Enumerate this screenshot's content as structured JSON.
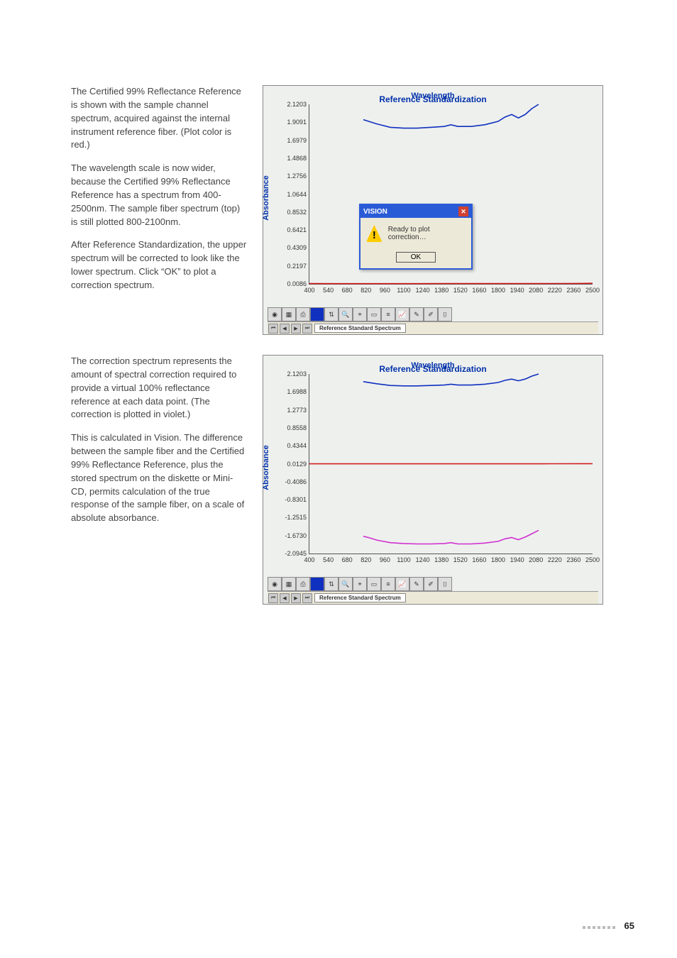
{
  "paragraphs": {
    "p1": "The Certified 99% Reflectance Reference is shown with the sample channel spectrum, acquired against the internal instrument reference fiber. (Plot color is red.)",
    "p2": "The wavelength scale is now wider, because the Certified 99% Reflectance Reference has a spectrum from 400-2500nm. The sample fiber spectrum (top) is still plotted 800-2100nm.",
    "p3": "After Reference Standardization, the upper spectrum will be corrected to look like the lower spectrum. Click “OK” to plot a correction spectrum.",
    "p4": "The correction spectrum represents the amount of spectral correction required to provide a virtual 100% reflectance reference at each data point. (The correction is plotted in violet.)",
    "p5": "This is calculated in Vision. The difference between the sample fiber and the Certified 99% Reflectance Reference, plus the stored spectrum on the diskette or Mini-CD, permits calculation of the true response of the sample fiber, on a scale of absolute absorbance."
  },
  "dialog": {
    "title": "VISION",
    "message": "Ready to plot correction…",
    "ok": "OK"
  },
  "tab": {
    "name": "Reference Standard Spectrum"
  },
  "page_number": "65",
  "chart_data": [
    {
      "type": "line",
      "title": "Reference Standardization",
      "xlabel": "Wavelength",
      "ylabel": "Absorbance",
      "xlim": [
        400,
        2500
      ],
      "ylim": [
        0.0086,
        2.1203
      ],
      "yticks": [
        2.1203,
        1.9091,
        1.6979,
        1.4868,
        1.2756,
        1.0644,
        0.8532,
        0.6421,
        0.4309,
        0.2197,
        0.0086
      ],
      "xticks": [
        400,
        540,
        680,
        820,
        960,
        1100,
        1240,
        1380,
        1520,
        1660,
        1800,
        1940,
        2080,
        2220,
        2360,
        2500
      ],
      "series": [
        {
          "name": "sample-fiber",
          "color": "#1030c0",
          "x": [
            800,
            900,
            1000,
            1100,
            1200,
            1300,
            1400,
            1450,
            1500,
            1600,
            1700,
            1800,
            1850,
            1900,
            1950,
            2000,
            2050,
            2100
          ],
          "y": [
            1.94,
            1.89,
            1.85,
            1.84,
            1.84,
            1.85,
            1.86,
            1.88,
            1.86,
            1.86,
            1.88,
            1.92,
            1.97,
            2.0,
            1.96,
            2.0,
            2.07,
            2.12
          ]
        },
        {
          "name": "reflectance-reference",
          "color": "#d02020",
          "x": [
            400,
            600,
            800,
            1000,
            1200,
            1400,
            1600,
            1800,
            2000,
            2200,
            2400,
            2500
          ],
          "y": [
            0.012,
            0.011,
            0.011,
            0.011,
            0.011,
            0.012,
            0.012,
            0.012,
            0.012,
            0.013,
            0.014,
            0.015
          ]
        }
      ]
    },
    {
      "type": "line",
      "title": "Reference Standardization",
      "xlabel": "Wavelength",
      "ylabel": "Absorbance",
      "xlim": [
        400,
        2500
      ],
      "ylim": [
        -2.0945,
        2.1203
      ],
      "yticks": [
        2.1203,
        1.6988,
        1.2773,
        0.8558,
        0.4344,
        0.0129,
        -0.4086,
        -0.8301,
        -1.2515,
        -1.673,
        -2.0945
      ],
      "xticks": [
        400,
        540,
        680,
        820,
        960,
        1100,
        1240,
        1380,
        1520,
        1660,
        1800,
        1940,
        2080,
        2220,
        2360,
        2500
      ],
      "series": [
        {
          "name": "sample-fiber",
          "color": "#1030c0",
          "x": [
            800,
            900,
            1000,
            1100,
            1200,
            1300,
            1400,
            1450,
            1500,
            1600,
            1700,
            1800,
            1850,
            1900,
            1950,
            2000,
            2050,
            2100
          ],
          "y": [
            1.94,
            1.89,
            1.85,
            1.84,
            1.84,
            1.85,
            1.86,
            1.88,
            1.86,
            1.86,
            1.88,
            1.92,
            1.97,
            2.0,
            1.96,
            2.0,
            2.07,
            2.12
          ]
        },
        {
          "name": "reflectance-reference",
          "color": "#d02020",
          "x": [
            400,
            600,
            800,
            1000,
            1200,
            1400,
            1600,
            1800,
            2000,
            2200,
            2400,
            2500
          ],
          "y": [
            0.012,
            0.011,
            0.011,
            0.011,
            0.011,
            0.012,
            0.012,
            0.012,
            0.012,
            0.013,
            0.014,
            0.015
          ]
        },
        {
          "name": "correction",
          "color": "#d030d0",
          "x": [
            800,
            850,
            900,
            1000,
            1100,
            1200,
            1300,
            1400,
            1450,
            1500,
            1600,
            1700,
            1800,
            1850,
            1900,
            1950,
            2000,
            2050,
            2100
          ],
          "y": [
            -1.69,
            -1.73,
            -1.78,
            -1.84,
            -1.86,
            -1.87,
            -1.87,
            -1.86,
            -1.84,
            -1.87,
            -1.87,
            -1.85,
            -1.81,
            -1.75,
            -1.72,
            -1.77,
            -1.71,
            -1.63,
            -1.55
          ]
        }
      ]
    }
  ]
}
